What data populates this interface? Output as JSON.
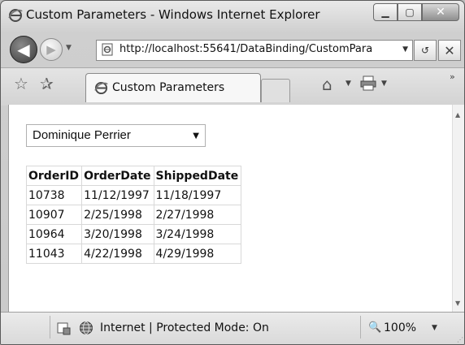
{
  "window": {
    "title": "Custom Parameters - Windows Internet Explorer",
    "minimize_glyph": "▁",
    "maximize_glyph": "▢",
    "close_glyph": "✕"
  },
  "nav": {
    "back_glyph": "◀",
    "forward_glyph": "▶",
    "dropdown_glyph": "▼",
    "address_url": "http://localhost:55641/DataBinding/CustomPara",
    "refresh_glyph": "↺",
    "stop_glyph": "✕"
  },
  "toolbar": {
    "favorites_glyph": "☆",
    "add_favorites_glyph": "✰",
    "tab_title": "Custom Parameters",
    "home_glyph": "⌂",
    "dropdown_glyph": "▼",
    "chevron_glyph": "»"
  },
  "page": {
    "customer_select": {
      "selected": "Dominique Perrier",
      "arrow_glyph": "▼"
    },
    "table": {
      "headers": [
        "OrderID",
        "OrderDate",
        "ShippedDate"
      ],
      "rows": [
        [
          "10738",
          "11/12/1997",
          "11/18/1997"
        ],
        [
          "10907",
          "2/25/1998",
          "2/27/1998"
        ],
        [
          "10964",
          "3/20/1998",
          "3/24/1998"
        ],
        [
          "11043",
          "4/22/1998",
          "4/29/1998"
        ]
      ]
    },
    "scroll_up_glyph": "▲",
    "scroll_down_glyph": "▼"
  },
  "status": {
    "zone_text": "Internet | Protected Mode: On",
    "zoom_glyph": "🔍",
    "zoom_level": "100%",
    "zoom_dropdown_glyph": "▼",
    "grip_glyph": "⋰"
  },
  "icons": {
    "ie_logo": "ie-logo-icon",
    "globe": "globe-icon",
    "page": "page-icon",
    "printer": "printer-icon"
  }
}
